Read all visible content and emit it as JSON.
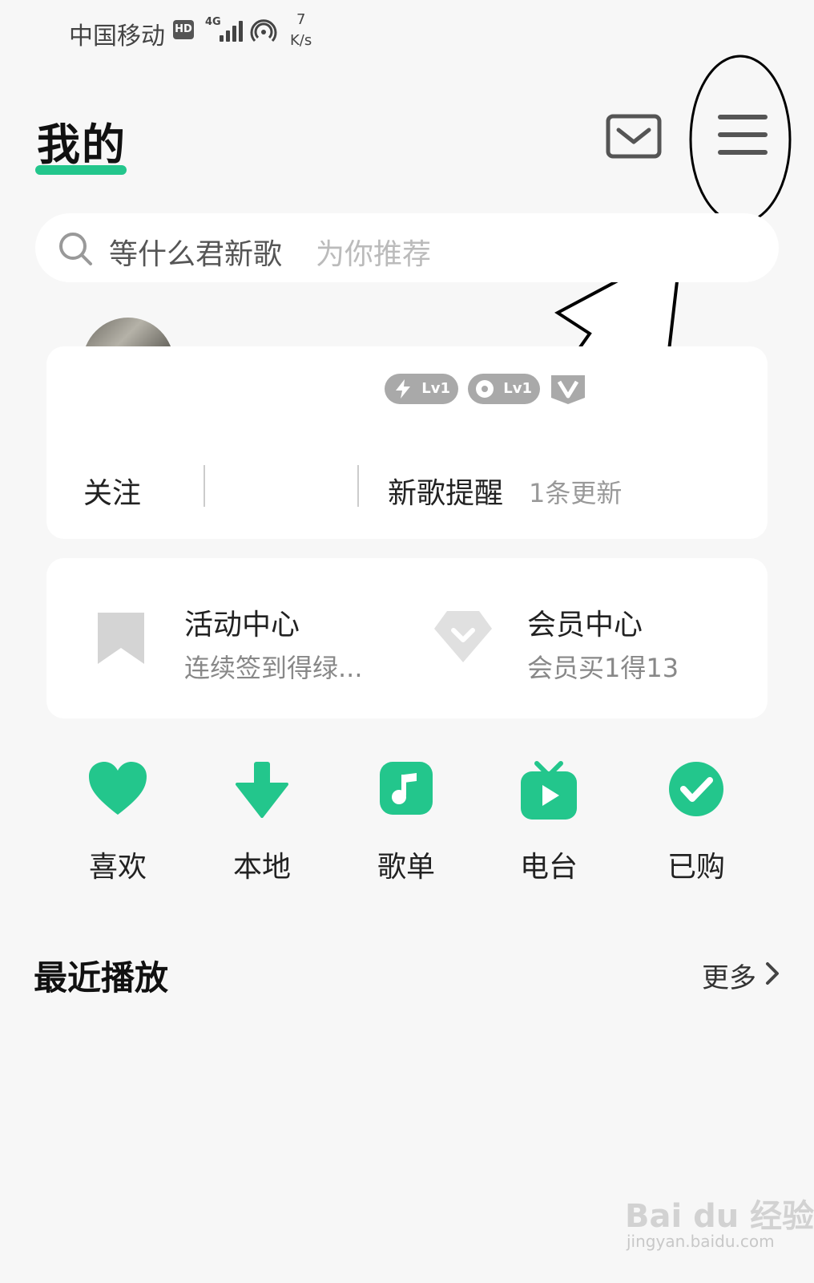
{
  "status_bar": {
    "carrier": "中国移动",
    "hd": "HD",
    "network": "4G",
    "speed_value": "7",
    "speed_unit": "K/s"
  },
  "header": {
    "title": "我的",
    "message_icon": "mail-icon",
    "menu_icon": "hamburger-menu-icon"
  },
  "search": {
    "query": "等什么君新歌",
    "hint": "为你推荐"
  },
  "profile": {
    "badges": [
      {
        "icon": "lightning-icon",
        "level": "Lv1"
      },
      {
        "icon": "disc-icon",
        "level": "Lv1"
      },
      {
        "icon": "v-badge-icon"
      }
    ],
    "follow_label": "关注",
    "new_songs_label": "新歌提醒",
    "new_songs_count": "1条更新"
  },
  "center": {
    "activity": {
      "title": "活动中心",
      "subtitle": "连续签到得绿..."
    },
    "member": {
      "title": "会员中心",
      "subtitle": "会员买1得13"
    }
  },
  "quick_links": [
    {
      "label": "喜欢",
      "icon": "heart-icon"
    },
    {
      "label": "本地",
      "icon": "download-icon"
    },
    {
      "label": "歌单",
      "icon": "music-note-icon"
    },
    {
      "label": "电台",
      "icon": "tv-radio-icon"
    },
    {
      "label": "已购",
      "icon": "check-circle-icon"
    }
  ],
  "recent": {
    "title": "最近播放",
    "more": "更多"
  },
  "watermark": {
    "text": "Bai du 经验",
    "url": "jingyan.baidu.com"
  },
  "colors": {
    "accent": "#23c68c",
    "background": "#f7f7f7",
    "card": "#ffffff"
  }
}
